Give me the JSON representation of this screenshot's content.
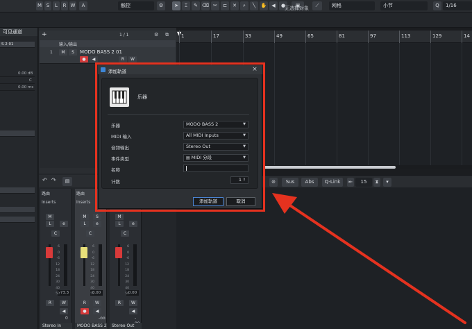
{
  "toolbar": {
    "mode_buttons": [
      "M",
      "S",
      "L",
      "R",
      "W",
      "A"
    ],
    "automation_mode": "触控",
    "snap_type": "网格",
    "grid": "小节",
    "quantize": "1/16"
  },
  "status_text": "无选择对象",
  "inspector": {
    "title": "可见通道",
    "track_name": "S 2 01",
    "value_delay": "0.00 dB",
    "value_c": "C",
    "value_ms": "0.00 ms"
  },
  "tracklist": {
    "count": "1 / 1",
    "input_output_label": "输入/输出",
    "track_number": "1",
    "track_name": "MODO BASS 2 01",
    "btn_m": "M",
    "btn_s": "S",
    "btn_r": "R",
    "btn_w": "W"
  },
  "ruler": {
    "numbers": [
      "1",
      "17",
      "33",
      "49",
      "65",
      "81",
      "97",
      "113",
      "129",
      "14"
    ]
  },
  "lower_editor": {
    "sus": "Sus",
    "abs": "Abs",
    "qlink": "Q-Link",
    "value": "15"
  },
  "mixer": {
    "route_label": "路由",
    "inserts_label": "Inserts",
    "strips": [
      {
        "name": "Stereo In",
        "vol": "-73.3",
        "pan": "0",
        "selected": false,
        "fader_color": "#d83a3a"
      },
      {
        "name": "MODO BASS 2",
        "vol": "0.00",
        "pan": "-oo",
        "selected": true,
        "fader_color": "#e8e07a"
      },
      {
        "name": "Stereo Out",
        "vol": "0.00",
        "pan": "-oo",
        "selected": false,
        "fader_color": "#d83a3a"
      }
    ],
    "scale": [
      "6",
      "0",
      "-6",
      "12",
      "18",
      "24",
      "30",
      "40",
      "50"
    ]
  },
  "dialog": {
    "title": "添加轨道",
    "category": "乐器",
    "fields": [
      {
        "label": "乐器",
        "value": "MODO BASS 2"
      },
      {
        "label": "MIDI 输入",
        "value": "All MIDI Inputs"
      },
      {
        "label": "音频输出",
        "value": "Stereo Out"
      },
      {
        "label": "事件类型",
        "value": "MIDI 分段"
      }
    ],
    "name_label": "名称",
    "name_value": "",
    "count_label": "计数",
    "count_value": "1",
    "add_button": "添加轨道",
    "cancel_button": "取消"
  },
  "colors": {
    "highlight": "#e5321f",
    "accent": "#4b84d2"
  }
}
